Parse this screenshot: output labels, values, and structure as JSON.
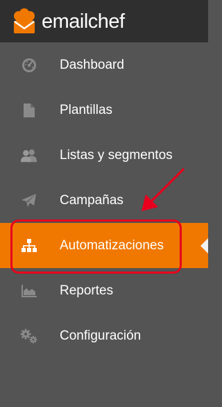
{
  "brand": {
    "name": "emailchef",
    "logo_icon": "chef-hat-envelope-icon",
    "accent": "#f07800",
    "header_bg": "#2f2f2f",
    "sidebar_bg": "#545454"
  },
  "sidebar": {
    "items": [
      {
        "id": "dashboard",
        "label": "Dashboard",
        "icon": "dashboard-gauge-icon",
        "active": false
      },
      {
        "id": "plantillas",
        "label": "Plantillas",
        "icon": "document-icon",
        "active": false
      },
      {
        "id": "listas",
        "label": "Listas y segmentos",
        "icon": "users-icon",
        "active": false
      },
      {
        "id": "campanas",
        "label": "Campañas",
        "icon": "paper-plane-icon",
        "active": false
      },
      {
        "id": "automatizaciones",
        "label": "Automatizaciones",
        "icon": "sitemap-icon",
        "active": true
      },
      {
        "id": "reportes",
        "label": "Reportes",
        "icon": "area-chart-icon",
        "active": false
      },
      {
        "id": "configuracion",
        "label": "Configuración",
        "icon": "gears-icon",
        "active": false
      }
    ]
  },
  "annotation": {
    "highlight_color": "#e8001c",
    "target": "automatizaciones"
  }
}
